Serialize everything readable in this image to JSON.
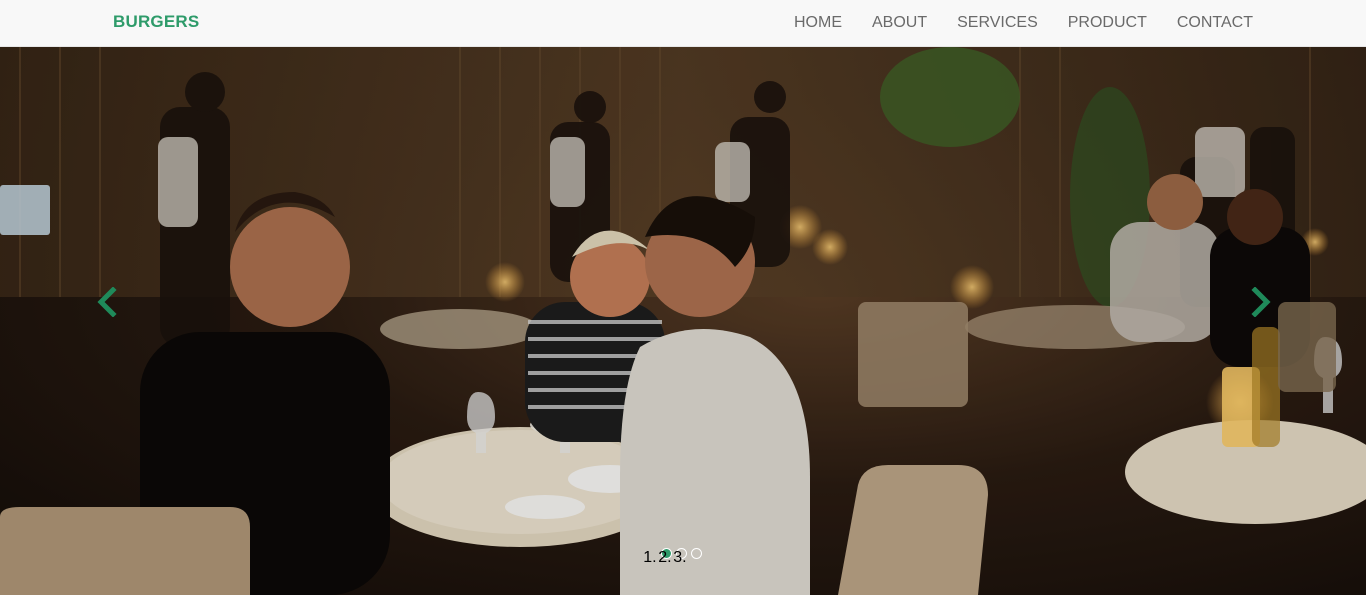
{
  "navbar": {
    "brand": "BURGERS",
    "links": [
      "HOME",
      "ABOUT",
      "SERVICES",
      "PRODUCT",
      "CONTACT"
    ]
  },
  "carousel": {
    "slide_count": 3,
    "active_index": 0,
    "prev_icon": "chevron-left-icon",
    "next_icon": "chevron-right-icon"
  },
  "colors": {
    "accent": "#2e9b6a",
    "navbar_bg": "#f8f8f8",
    "nav_text": "#6a6a6a"
  }
}
